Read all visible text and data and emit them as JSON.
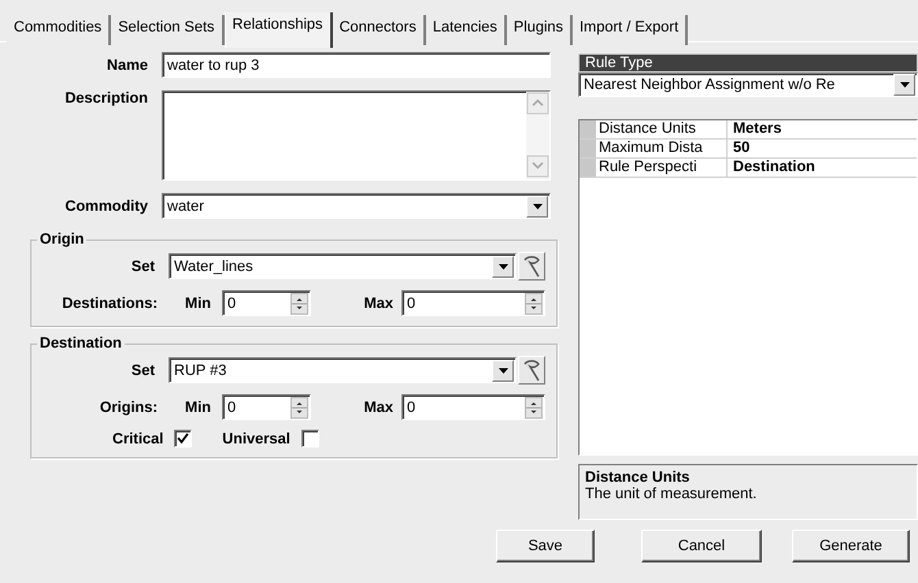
{
  "tabs": [
    {
      "label": "Commodities",
      "selected": false
    },
    {
      "label": "Selection Sets",
      "selected": false
    },
    {
      "label": "Relationships",
      "selected": true
    },
    {
      "label": "Connectors",
      "selected": false
    },
    {
      "label": "Latencies",
      "selected": false
    },
    {
      "label": "Plugins",
      "selected": false
    },
    {
      "label": "Import / Export",
      "selected": false
    }
  ],
  "form": {
    "name": {
      "label": "Name",
      "value": "water to rup 3"
    },
    "description": {
      "label": "Description"
    },
    "commodity": {
      "label": "Commodity",
      "value": "water"
    },
    "groups": [
      {
        "title": "Origin",
        "set_label": "Set",
        "set_value": "Water_lines",
        "count_label": "Destinations:",
        "min_label": "Min",
        "min_value": "0",
        "max_label": "Max",
        "max_value": "0"
      },
      {
        "title": "Destination",
        "set_label": "Set",
        "set_value": "RUP #3",
        "count_label": "Origins:",
        "min_label": "Min",
        "min_value": "0",
        "max_label": "Max",
        "max_value": "0",
        "checkboxes": [
          {
            "label": "Critical",
            "checked": true
          },
          {
            "label": "Universal",
            "checked": false
          }
        ]
      }
    ]
  },
  "rule_type": {
    "title": "Rule Type",
    "value": "Nearest Neighbor Assignment w/o Re"
  },
  "properties": [
    {
      "name": "Distance Units",
      "value": "Meters"
    },
    {
      "name": "Maximum Dista",
      "value": "50"
    },
    {
      "name": "Rule Perspecti",
      "value": "Destination"
    }
  ],
  "help": {
    "title": "Distance Units",
    "text": "The unit of measurement."
  },
  "buttons": [
    "Save",
    "Cancel",
    "Generate"
  ]
}
